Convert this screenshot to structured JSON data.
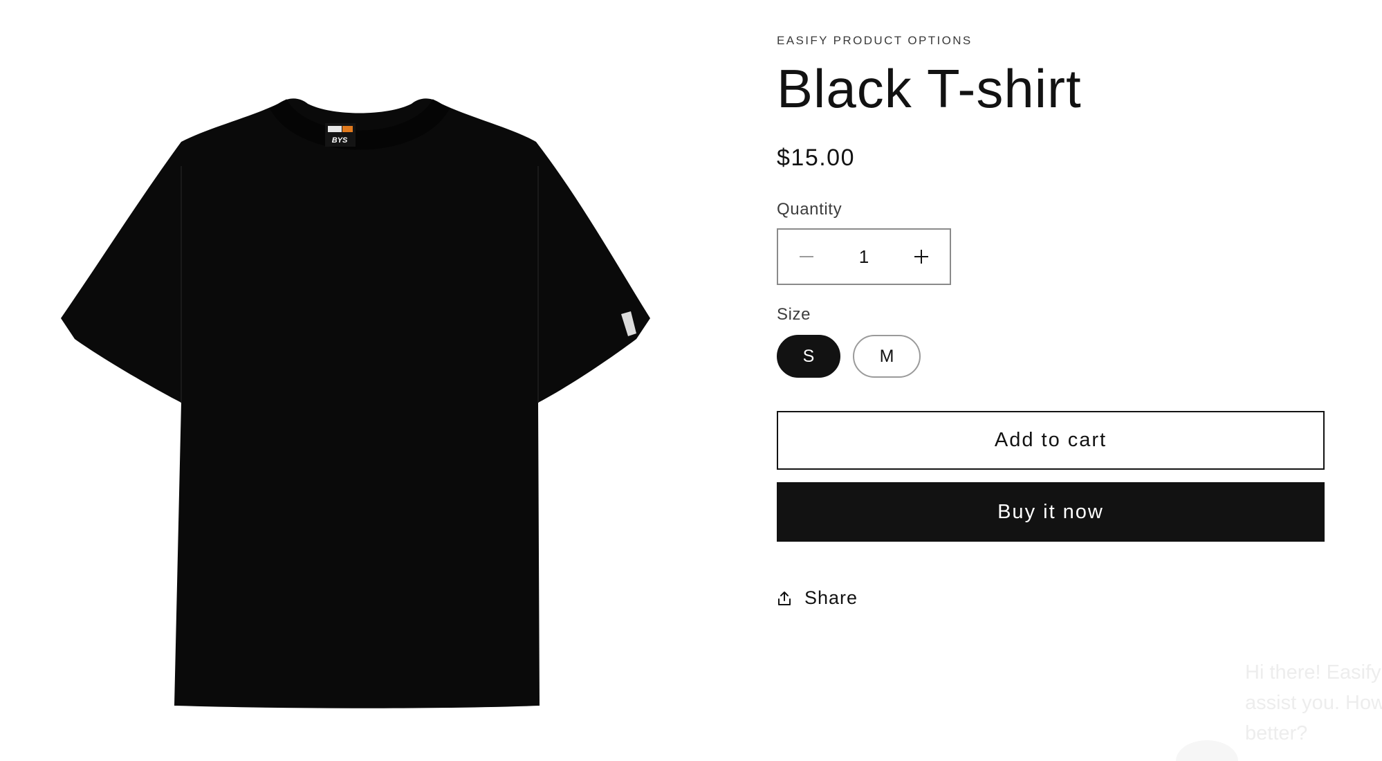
{
  "product": {
    "vendor": "EASIFY PRODUCT OPTIONS",
    "title": "Black T-shirt",
    "price": "$15.00",
    "image_alt": "Black T-shirt with BYS neck label"
  },
  "quantity": {
    "label": "Quantity",
    "value": "1",
    "decrease_icon": "minus-icon",
    "increase_icon": "plus-icon"
  },
  "size": {
    "label": "Size",
    "options": [
      "S",
      "M"
    ],
    "selected": "S"
  },
  "actions": {
    "add_to_cart": "Add to cart",
    "buy_now": "Buy it now",
    "share": "Share",
    "share_icon": "share-icon"
  },
  "chat": {
    "lines": [
      "Hi there! Easify",
      "assist you. How",
      "better? "
    ]
  },
  "colors": {
    "primary": "#121212",
    "background": "#ffffff",
    "border": "#8a8a8a"
  }
}
